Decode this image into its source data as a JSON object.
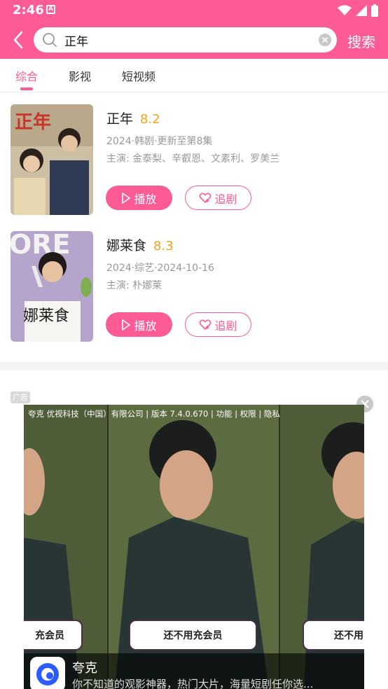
{
  "status_bar": {
    "time": "2:46",
    "notif_glyph": "A"
  },
  "header": {
    "search_value": "正年",
    "search_button": "搜索",
    "bg_color": "#fd5b96"
  },
  "tabs": [
    {
      "label": "综合",
      "active": true
    },
    {
      "label": "影视",
      "active": false
    },
    {
      "label": "短视频",
      "active": false
    }
  ],
  "results": [
    {
      "title": "正年",
      "score": "8.2",
      "info": "2024·韩剧·更新至第8集",
      "cast": "主演: 金泰梨、辛叡恩、文素利、罗美兰",
      "poster_title": "正年",
      "play_label": "播放",
      "follow_label": "追剧"
    },
    {
      "title": "娜莱食",
      "score": "8.3",
      "info": "2024·综艺·2024-10-16",
      "cast": "主演: 朴娜莱",
      "poster_title": "娜莱食",
      "poster_banner": "ORE",
      "play_label": "播放",
      "follow_label": "追剧"
    }
  ],
  "ad": {
    "badge": "广告",
    "company_line": "夸克 优视科技（中国）有限公司 | 版本 7.4.0.670 | 功能 | 权限 | 隐私",
    "banner_left": "充会员",
    "banner_center": "还不用充会员",
    "banner_right": "还不用",
    "app_name": "夸克",
    "app_desc": "你不知道的观影神器，热门大片，海量短剧任你选..."
  }
}
